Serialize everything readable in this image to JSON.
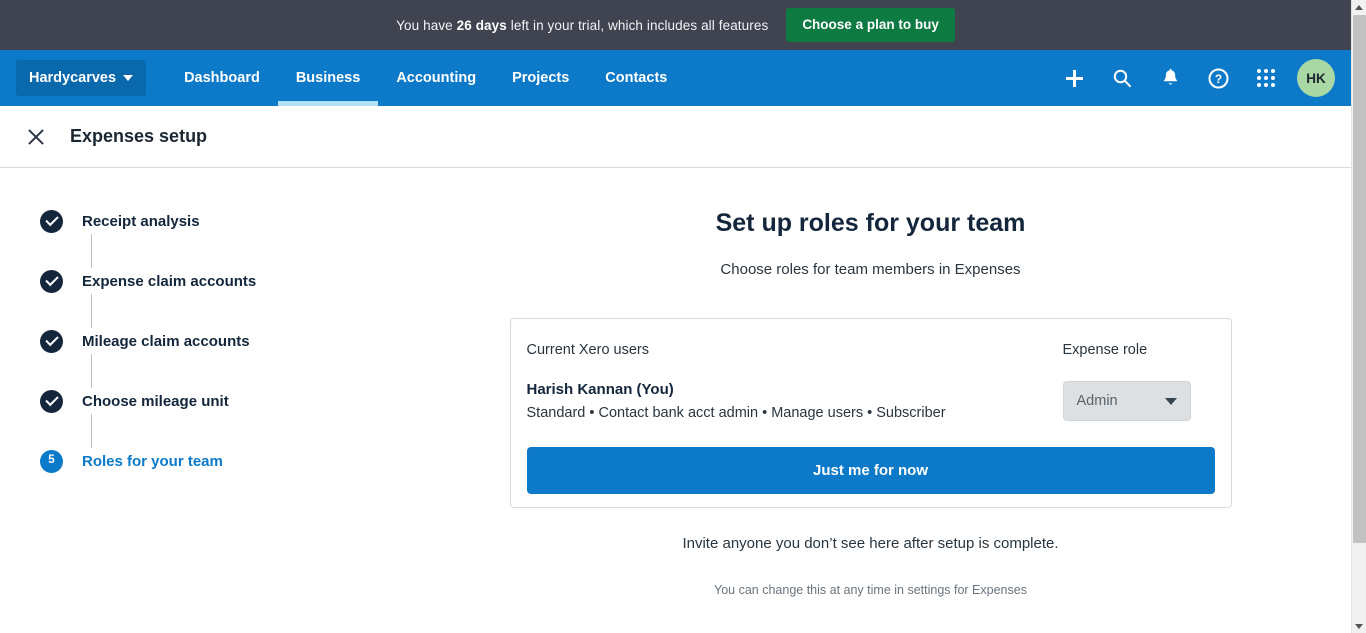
{
  "trial_banner": {
    "text_before": "You have ",
    "days": "26 days",
    "text_after": " left in your trial, which includes all features",
    "cta_label": "Choose a plan to buy",
    "cta_color": "#0d7a42",
    "background": "#404350"
  },
  "nav": {
    "org_name": "Hardycarves",
    "background": "#0c7ac9",
    "links": [
      {
        "label": "Dashboard",
        "active": false
      },
      {
        "label": "Business",
        "active": true
      },
      {
        "label": "Accounting",
        "active": false
      },
      {
        "label": "Projects",
        "active": false
      },
      {
        "label": "Contacts",
        "active": false
      }
    ],
    "icons": [
      {
        "name": "plus-icon",
        "glyph": "+"
      },
      {
        "name": "search-icon",
        "glyph": "⌕"
      },
      {
        "name": "notifications-bell-icon",
        "glyph": "🔔"
      },
      {
        "name": "help-icon",
        "glyph": "?"
      },
      {
        "name": "app-grid-icon",
        "glyph": "∷"
      }
    ],
    "avatar_initials": "HK",
    "avatar_color": "#a9d8a4"
  },
  "setup_header": {
    "close_icon": "close-icon",
    "title": "Expenses setup"
  },
  "steps": [
    {
      "label": "Receipt analysis",
      "state": "complete",
      "marker": "✓"
    },
    {
      "label": "Expense claim accounts",
      "state": "complete",
      "marker": "✓"
    },
    {
      "label": "Mileage claim accounts",
      "state": "complete",
      "marker": "✓"
    },
    {
      "label": "Choose mileage unit",
      "state": "complete",
      "marker": "✓"
    },
    {
      "label": "Roles for your team",
      "state": "current",
      "marker": "5"
    }
  ],
  "panel": {
    "title": "Set up roles for your team",
    "subtitle": "Choose roles for team members in Expenses",
    "card": {
      "col_users_header": "Current Xero users",
      "col_role_header": "Expense role",
      "user": {
        "name": "Harish Kannan (You)",
        "permissions": "Standard • Contact bank acct admin • Manage users • Subscriber",
        "role_value": "Admin"
      },
      "primary_button": "Just me for now"
    },
    "footnote": "Invite anyone you don’t see here after setup is complete.",
    "subfootnote": "You can change this at any time in settings for Expenses"
  },
  "colors": {
    "accent_blue": "#0c7ac9",
    "step_complete": "#13263c",
    "green_cta": "#0d7a42"
  }
}
